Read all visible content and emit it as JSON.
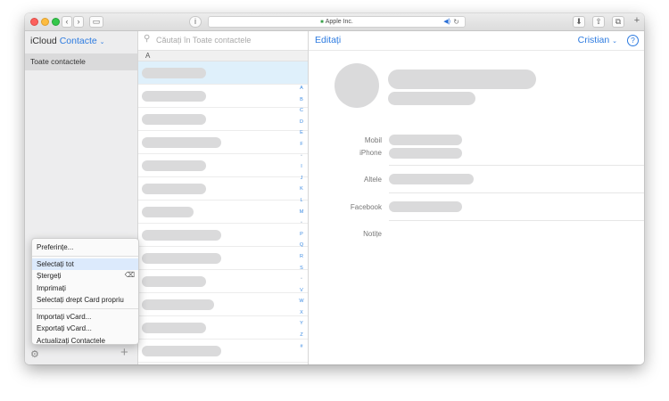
{
  "browser": {
    "address": "Apple Inc.",
    "reload_icon": "reload-icon",
    "sound_icon": "speaker-icon"
  },
  "sidebar": {
    "app_name": "iCloud",
    "app_section": "Contacte",
    "groups": [
      {
        "label": "Toate contactele"
      }
    ]
  },
  "list": {
    "search_placeholder": "Căutați în Toate contactele",
    "section_letter": "A",
    "index_letters": [
      "A",
      "B",
      "C",
      "D",
      "E",
      "F",
      "•",
      "I",
      "J",
      "K",
      "L",
      "M",
      "•",
      "P",
      "Q",
      "R",
      "S",
      "•",
      "V",
      "W",
      "X",
      "Y",
      "Z",
      "#"
    ]
  },
  "detail": {
    "edit_label": "Editați",
    "user_label": "Cristian",
    "help_label": "?",
    "fields": {
      "mobil": "Mobil",
      "iphone": "iPhone",
      "altele": "Altele",
      "facebook": "Facebook",
      "notite": "Notițe"
    }
  },
  "menu": {
    "items": [
      {
        "label": "Preferințe..."
      },
      {
        "label": "Selectați tot"
      },
      {
        "label": "Ștergeți"
      },
      {
        "label": "Imprimați"
      },
      {
        "label": "Selectați drept Card propriu"
      },
      {
        "label": "Importați vCard..."
      },
      {
        "label": "Exportați vCard..."
      },
      {
        "label": "Actualizați Contactele"
      }
    ]
  },
  "colors": {
    "accent": "#2d7be0",
    "selection": "#dff0fb",
    "placeholder_pill": "#dadadb"
  }
}
